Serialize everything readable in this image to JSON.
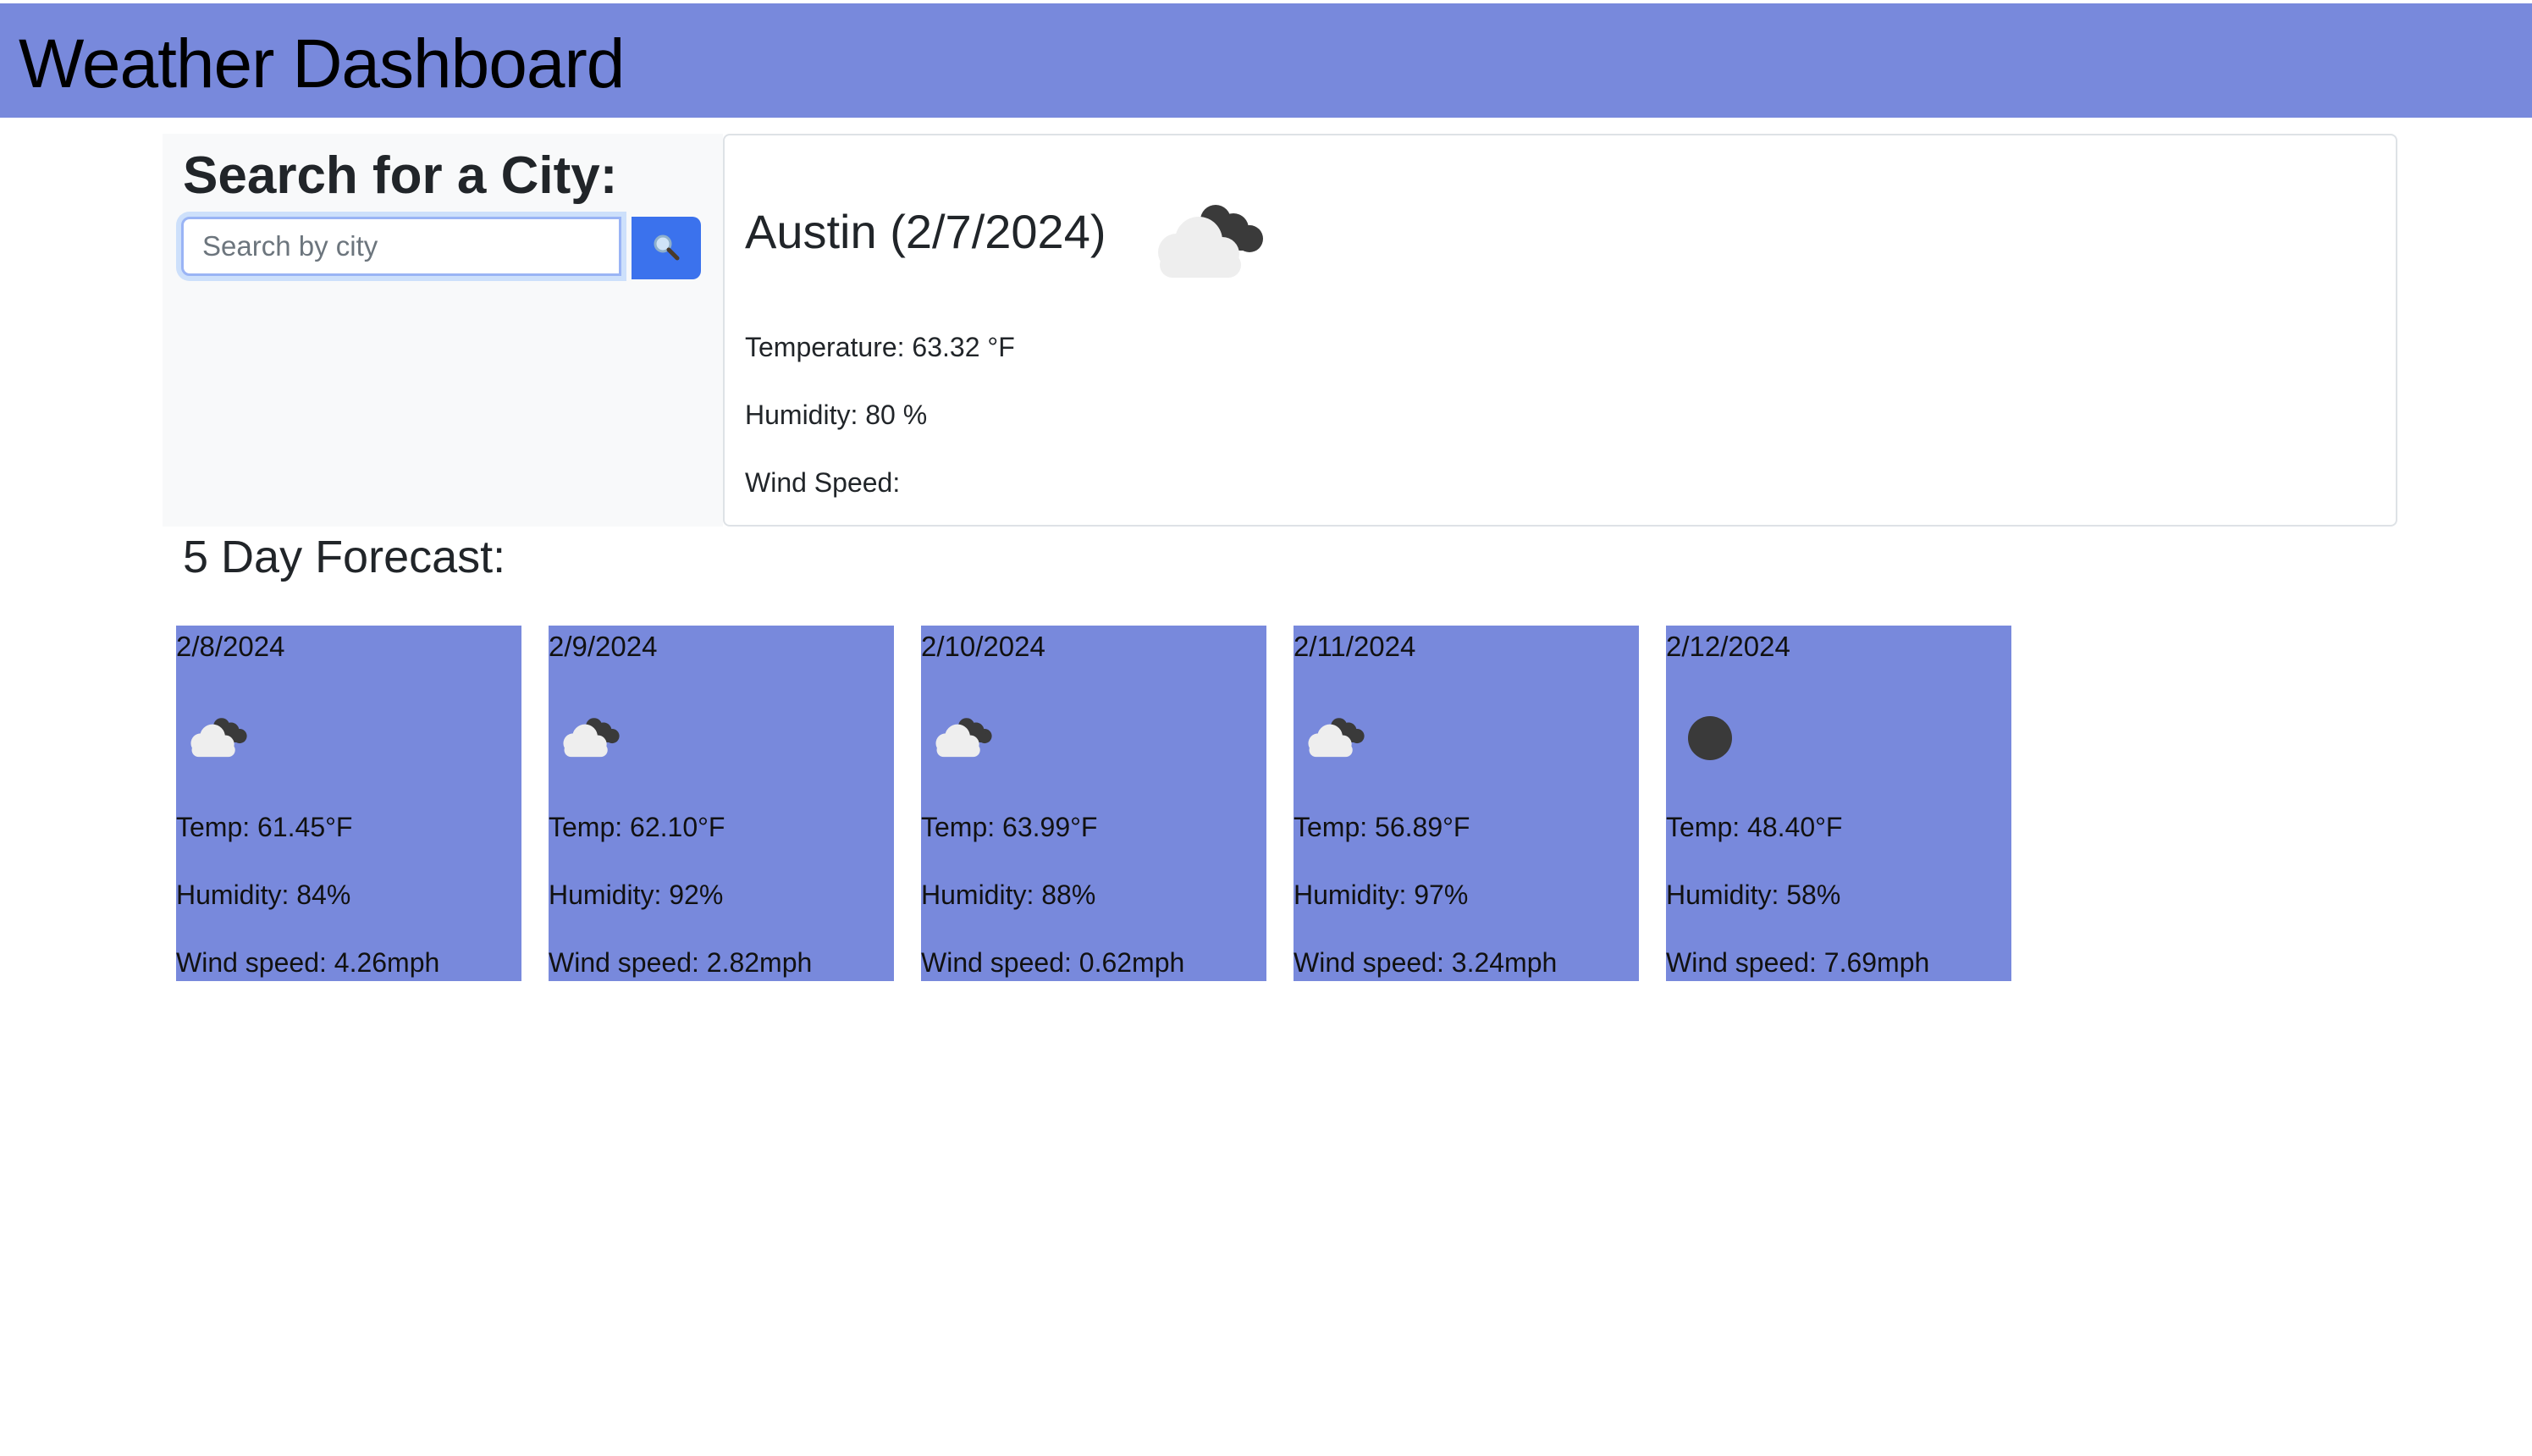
{
  "header": {
    "title": "Weather Dashboard",
    "color": "#7889dc"
  },
  "search": {
    "heading": "Search for a City:",
    "placeholder": "Search by city",
    "value": "",
    "button_icon": "search-icon",
    "button_color": "#3b72ed"
  },
  "current": {
    "title": "Austin (2/7/2024)",
    "icon": "broken-clouds-icon",
    "temperature": "Temperature: 63.32 °F",
    "humidity": "Humidity: 80 %",
    "wind": "Wind Speed:"
  },
  "forecast": {
    "heading": "5 Day Forecast:",
    "card_color": "#7889dc",
    "days": [
      {
        "date": "2/8/2024",
        "icon": "broken-clouds-icon",
        "temp": "Temp: 61.45°F",
        "humidity": "Humidity: 84%",
        "wind": "Wind speed: 4.26mph"
      },
      {
        "date": "2/9/2024",
        "icon": "broken-clouds-icon",
        "temp": "Temp: 62.10°F",
        "humidity": "Humidity: 92%",
        "wind": "Wind speed: 2.82mph"
      },
      {
        "date": "2/10/2024",
        "icon": "broken-clouds-icon",
        "temp": "Temp: 63.99°F",
        "humidity": "Humidity: 88%",
        "wind": "Wind speed: 0.62mph"
      },
      {
        "date": "2/11/2024",
        "icon": "broken-clouds-icon",
        "temp": "Temp: 56.89°F",
        "humidity": "Humidity: 97%",
        "wind": "Wind speed: 3.24mph"
      },
      {
        "date": "2/12/2024",
        "icon": "overcast-clouds-icon",
        "temp": "Temp: 48.40°F",
        "humidity": "Humidity: 58%",
        "wind": "Wind speed: 7.69mph"
      }
    ]
  }
}
